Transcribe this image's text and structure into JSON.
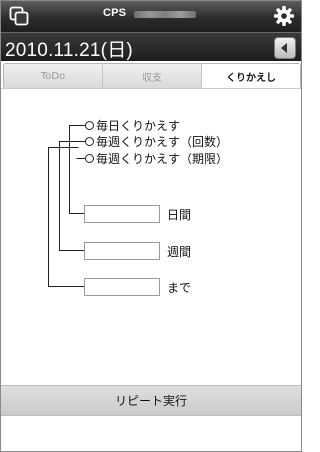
{
  "statusbar": {
    "title": "CPS",
    "app_icon": "window-icon",
    "settings_icon": "gear-icon"
  },
  "datebar": {
    "date": "2010.11.21(日)",
    "back_icon": "chevron-left-icon"
  },
  "tabs": [
    {
      "label": "ToDo",
      "active": false
    },
    {
      "label": "収支",
      "active": false
    },
    {
      "label": "くりかえし",
      "active": true
    }
  ],
  "options": [
    {
      "label": "毎日くりかえす"
    },
    {
      "label": "毎週くりかえす（回数）"
    },
    {
      "label": "毎週くりかえす（期限）"
    }
  ],
  "fields": [
    {
      "label": "日間",
      "value": ""
    },
    {
      "label": "週間",
      "value": ""
    },
    {
      "label": "まで",
      "value": ""
    }
  ],
  "action": {
    "label": "リピート実行"
  }
}
